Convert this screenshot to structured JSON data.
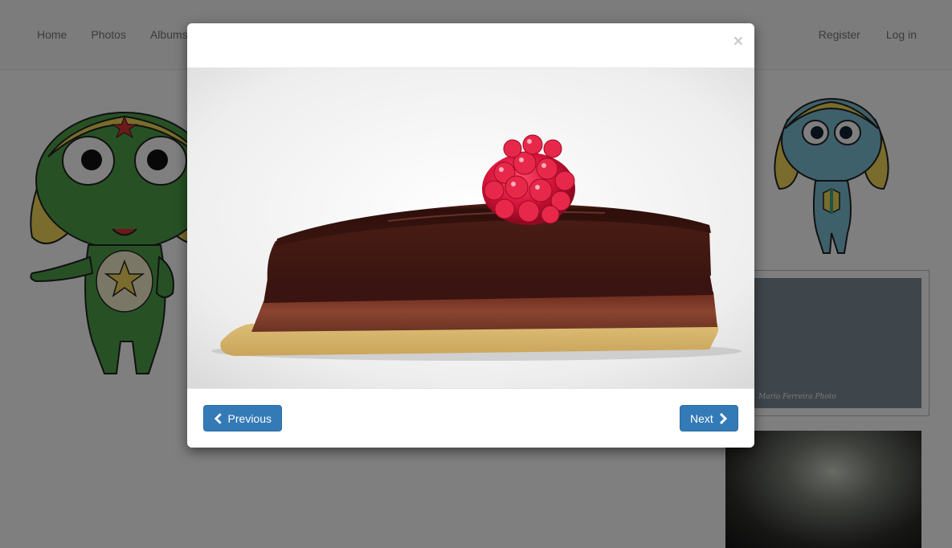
{
  "navbar": {
    "left_items": [
      "Home",
      "Photos",
      "Albums"
    ],
    "right_items": [
      "Register",
      "Log in"
    ]
  },
  "sidebar": {
    "thumb1_credit": "Mario Ferreira Photo"
  },
  "modal": {
    "close_label": "×",
    "prev_label": "Previous",
    "next_label": "Next",
    "prev_icon": "chevron-left-icon",
    "next_icon": "chevron-right-icon"
  },
  "colors": {
    "primary": "#337ab7",
    "backdrop": "rgba(0,0,0,0.5)"
  }
}
